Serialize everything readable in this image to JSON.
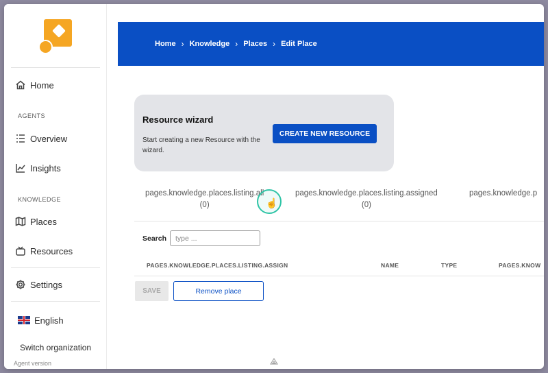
{
  "sidebar": {
    "home_label": "Home",
    "agents_section": "AGENTS",
    "overview_label": "Overview",
    "insights_label": "Insights",
    "knowledge_section": "KNOWLEDGE",
    "places_label": "Places",
    "resources_label": "Resources",
    "settings_label": "Settings",
    "language_label": "English",
    "switch_org_label": "Switch organization",
    "agent_version_label": "Agent version"
  },
  "breadcrumb": [
    "Home",
    "Knowledge",
    "Places",
    "Edit Place"
  ],
  "wizard": {
    "title": "Resource wizard",
    "description": "Start creating a new Resource with the wizard.",
    "button_label": "CREATE NEW RESOURCE"
  },
  "tabs": [
    {
      "label": "pages.knowledge.places.listing.all",
      "count": "(0)"
    },
    {
      "label": "pages.knowledge.places.listing.assigned",
      "count": "(0)"
    },
    {
      "label": "pages.knowledge.p",
      "count": ""
    }
  ],
  "search": {
    "label": "Search",
    "placeholder": "type ..."
  },
  "table": {
    "columns": [
      "PAGES.KNOWLEDGE.PLACES.LISTING.ASSIGN",
      "NAME",
      "TYPE",
      "PAGES.KNOW"
    ]
  },
  "actions": {
    "save_label": "SAVE",
    "remove_label": "Remove place"
  },
  "colors": {
    "primary": "#0a4fc4",
    "logo": "#f5a623",
    "cursor_highlight": "#2ec4a6"
  }
}
